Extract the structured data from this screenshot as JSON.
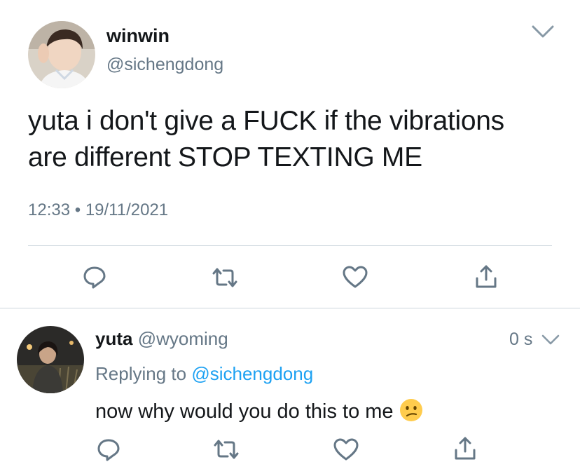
{
  "main_tweet": {
    "display_name": "winwin",
    "handle": "@sichengdong",
    "text_line1": "yuta i don't give a FUCK if the vibrations",
    "text_line2": "are different STOP TEXTING ME",
    "time": "12:33",
    "separator": "•",
    "date": "19/11/2021"
  },
  "reply": {
    "display_name": "yuta",
    "handle": "@wyoming",
    "age": "0 s",
    "replying_prefix": "Replying to",
    "replying_handle": "@sichengdong",
    "text": "now why would you do this to me",
    "emoji": "confused-face"
  },
  "actions": [
    "reply-icon",
    "retweet-icon",
    "like-icon",
    "share-icon"
  ],
  "colors": {
    "text": "#14171a",
    "muted": "#657786",
    "link": "#1da1f2",
    "divider": "#ccd6dd"
  }
}
